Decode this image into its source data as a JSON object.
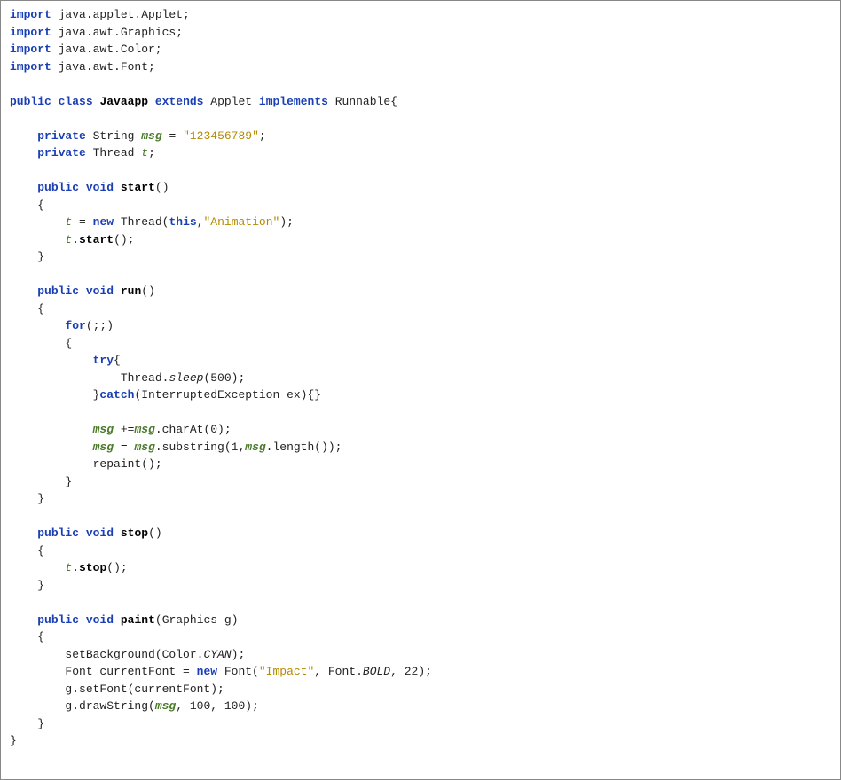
{
  "code": {
    "lines": [
      [
        {
          "cls": "kw",
          "t": "import"
        },
        {
          "t": " java.applet.Applet;"
        }
      ],
      [
        {
          "cls": "kw",
          "t": "import"
        },
        {
          "t": " java.awt.Graphics;"
        }
      ],
      [
        {
          "cls": "kw",
          "t": "import"
        },
        {
          "t": " java.awt.Color;"
        }
      ],
      [
        {
          "cls": "kw",
          "t": "import"
        },
        {
          "t": " java.awt.Font;"
        }
      ],
      [],
      [
        {
          "cls": "kw",
          "t": "public"
        },
        {
          "t": " "
        },
        {
          "cls": "kw",
          "t": "class"
        },
        {
          "t": " "
        },
        {
          "cls": "cls",
          "t": "Javaapp"
        },
        {
          "t": " "
        },
        {
          "cls": "kw",
          "t": "extends"
        },
        {
          "t": " Applet "
        },
        {
          "cls": "kw",
          "t": "implements"
        },
        {
          "t": " Runnable{"
        }
      ],
      [],
      [
        {
          "t": "    "
        },
        {
          "cls": "kw",
          "t": "private"
        },
        {
          "t": " String "
        },
        {
          "cls": "field",
          "t": "msg"
        },
        {
          "t": " = "
        },
        {
          "cls": "str",
          "t": "\"123456789\""
        },
        {
          "t": ";"
        }
      ],
      [
        {
          "t": "    "
        },
        {
          "cls": "kw",
          "t": "private"
        },
        {
          "t": " Thread "
        },
        {
          "cls": "var",
          "t": "t"
        },
        {
          "t": ";"
        }
      ],
      [],
      [
        {
          "t": "    "
        },
        {
          "cls": "kw",
          "t": "public"
        },
        {
          "t": " "
        },
        {
          "cls": "kw",
          "t": "void"
        },
        {
          "t": " "
        },
        {
          "cls": "method",
          "t": "start"
        },
        {
          "t": "()"
        }
      ],
      [
        {
          "t": "    {"
        }
      ],
      [
        {
          "t": "        "
        },
        {
          "cls": "var",
          "t": "t"
        },
        {
          "t": " = "
        },
        {
          "cls": "kw",
          "t": "new"
        },
        {
          "t": " Thread("
        },
        {
          "cls": "kw",
          "t": "this"
        },
        {
          "t": ","
        },
        {
          "cls": "str",
          "t": "\"Animation\""
        },
        {
          "t": ");"
        }
      ],
      [
        {
          "t": "        "
        },
        {
          "cls": "var",
          "t": "t"
        },
        {
          "t": "."
        },
        {
          "cls": "method",
          "t": "start"
        },
        {
          "t": "();"
        }
      ],
      [
        {
          "t": "    }"
        }
      ],
      [],
      [
        {
          "t": "    "
        },
        {
          "cls": "kw",
          "t": "public"
        },
        {
          "t": " "
        },
        {
          "cls": "kw",
          "t": "void"
        },
        {
          "t": " "
        },
        {
          "cls": "method",
          "t": "run"
        },
        {
          "t": "()"
        }
      ],
      [
        {
          "t": "    {"
        }
      ],
      [
        {
          "t": "        "
        },
        {
          "cls": "kw",
          "t": "for"
        },
        {
          "t": "(;;)"
        }
      ],
      [
        {
          "t": "        {"
        }
      ],
      [
        {
          "t": "            "
        },
        {
          "cls": "kw",
          "t": "try"
        },
        {
          "t": "{"
        }
      ],
      [
        {
          "t": "                Thread."
        },
        {
          "cls": "ital",
          "t": "sleep"
        },
        {
          "t": "(500);"
        }
      ],
      [
        {
          "t": "            }"
        },
        {
          "cls": "kw",
          "t": "catch"
        },
        {
          "t": "(InterruptedException ex){}"
        }
      ],
      [],
      [
        {
          "t": "            "
        },
        {
          "cls": "field",
          "t": "msg"
        },
        {
          "t": " +="
        },
        {
          "cls": "field",
          "t": "msg"
        },
        {
          "t": ".charAt(0);"
        }
      ],
      [
        {
          "t": "            "
        },
        {
          "cls": "field",
          "t": "msg"
        },
        {
          "t": " = "
        },
        {
          "cls": "field",
          "t": "msg"
        },
        {
          "t": ".substring(1,"
        },
        {
          "cls": "field",
          "t": "msg"
        },
        {
          "t": ".length());"
        }
      ],
      [
        {
          "t": "            repaint();"
        }
      ],
      [
        {
          "t": "        }"
        }
      ],
      [
        {
          "t": "    }"
        }
      ],
      [],
      [
        {
          "t": "    "
        },
        {
          "cls": "kw",
          "t": "public"
        },
        {
          "t": " "
        },
        {
          "cls": "kw",
          "t": "void"
        },
        {
          "t": " "
        },
        {
          "cls": "method",
          "t": "stop"
        },
        {
          "t": "()"
        }
      ],
      [
        {
          "t": "    {"
        }
      ],
      [
        {
          "t": "        "
        },
        {
          "cls": "var",
          "t": "t"
        },
        {
          "t": "."
        },
        {
          "cls": "method",
          "t": "stop"
        },
        {
          "t": "();"
        }
      ],
      [
        {
          "t": "    }"
        }
      ],
      [],
      [
        {
          "t": "    "
        },
        {
          "cls": "kw",
          "t": "public"
        },
        {
          "t": " "
        },
        {
          "cls": "kw",
          "t": "void"
        },
        {
          "t": " "
        },
        {
          "cls": "method",
          "t": "paint"
        },
        {
          "t": "(Graphics g)"
        }
      ],
      [
        {
          "t": "    {"
        }
      ],
      [
        {
          "t": "        setBackground(Color."
        },
        {
          "cls": "ital",
          "t": "CYAN"
        },
        {
          "t": ");"
        }
      ],
      [
        {
          "t": "        Font currentFont = "
        },
        {
          "cls": "kw",
          "t": "new"
        },
        {
          "t": " Font("
        },
        {
          "cls": "str",
          "t": "\"Impact\""
        },
        {
          "t": ", Font."
        },
        {
          "cls": "ital",
          "t": "BOLD"
        },
        {
          "t": ", 22);"
        }
      ],
      [
        {
          "t": "        g.setFont(currentFont);"
        }
      ],
      [
        {
          "t": "        g.drawString("
        },
        {
          "cls": "field",
          "t": "msg"
        },
        {
          "t": ", 100, 100);"
        }
      ],
      [
        {
          "t": "    }"
        }
      ],
      [
        {
          "t": "}"
        }
      ]
    ]
  }
}
